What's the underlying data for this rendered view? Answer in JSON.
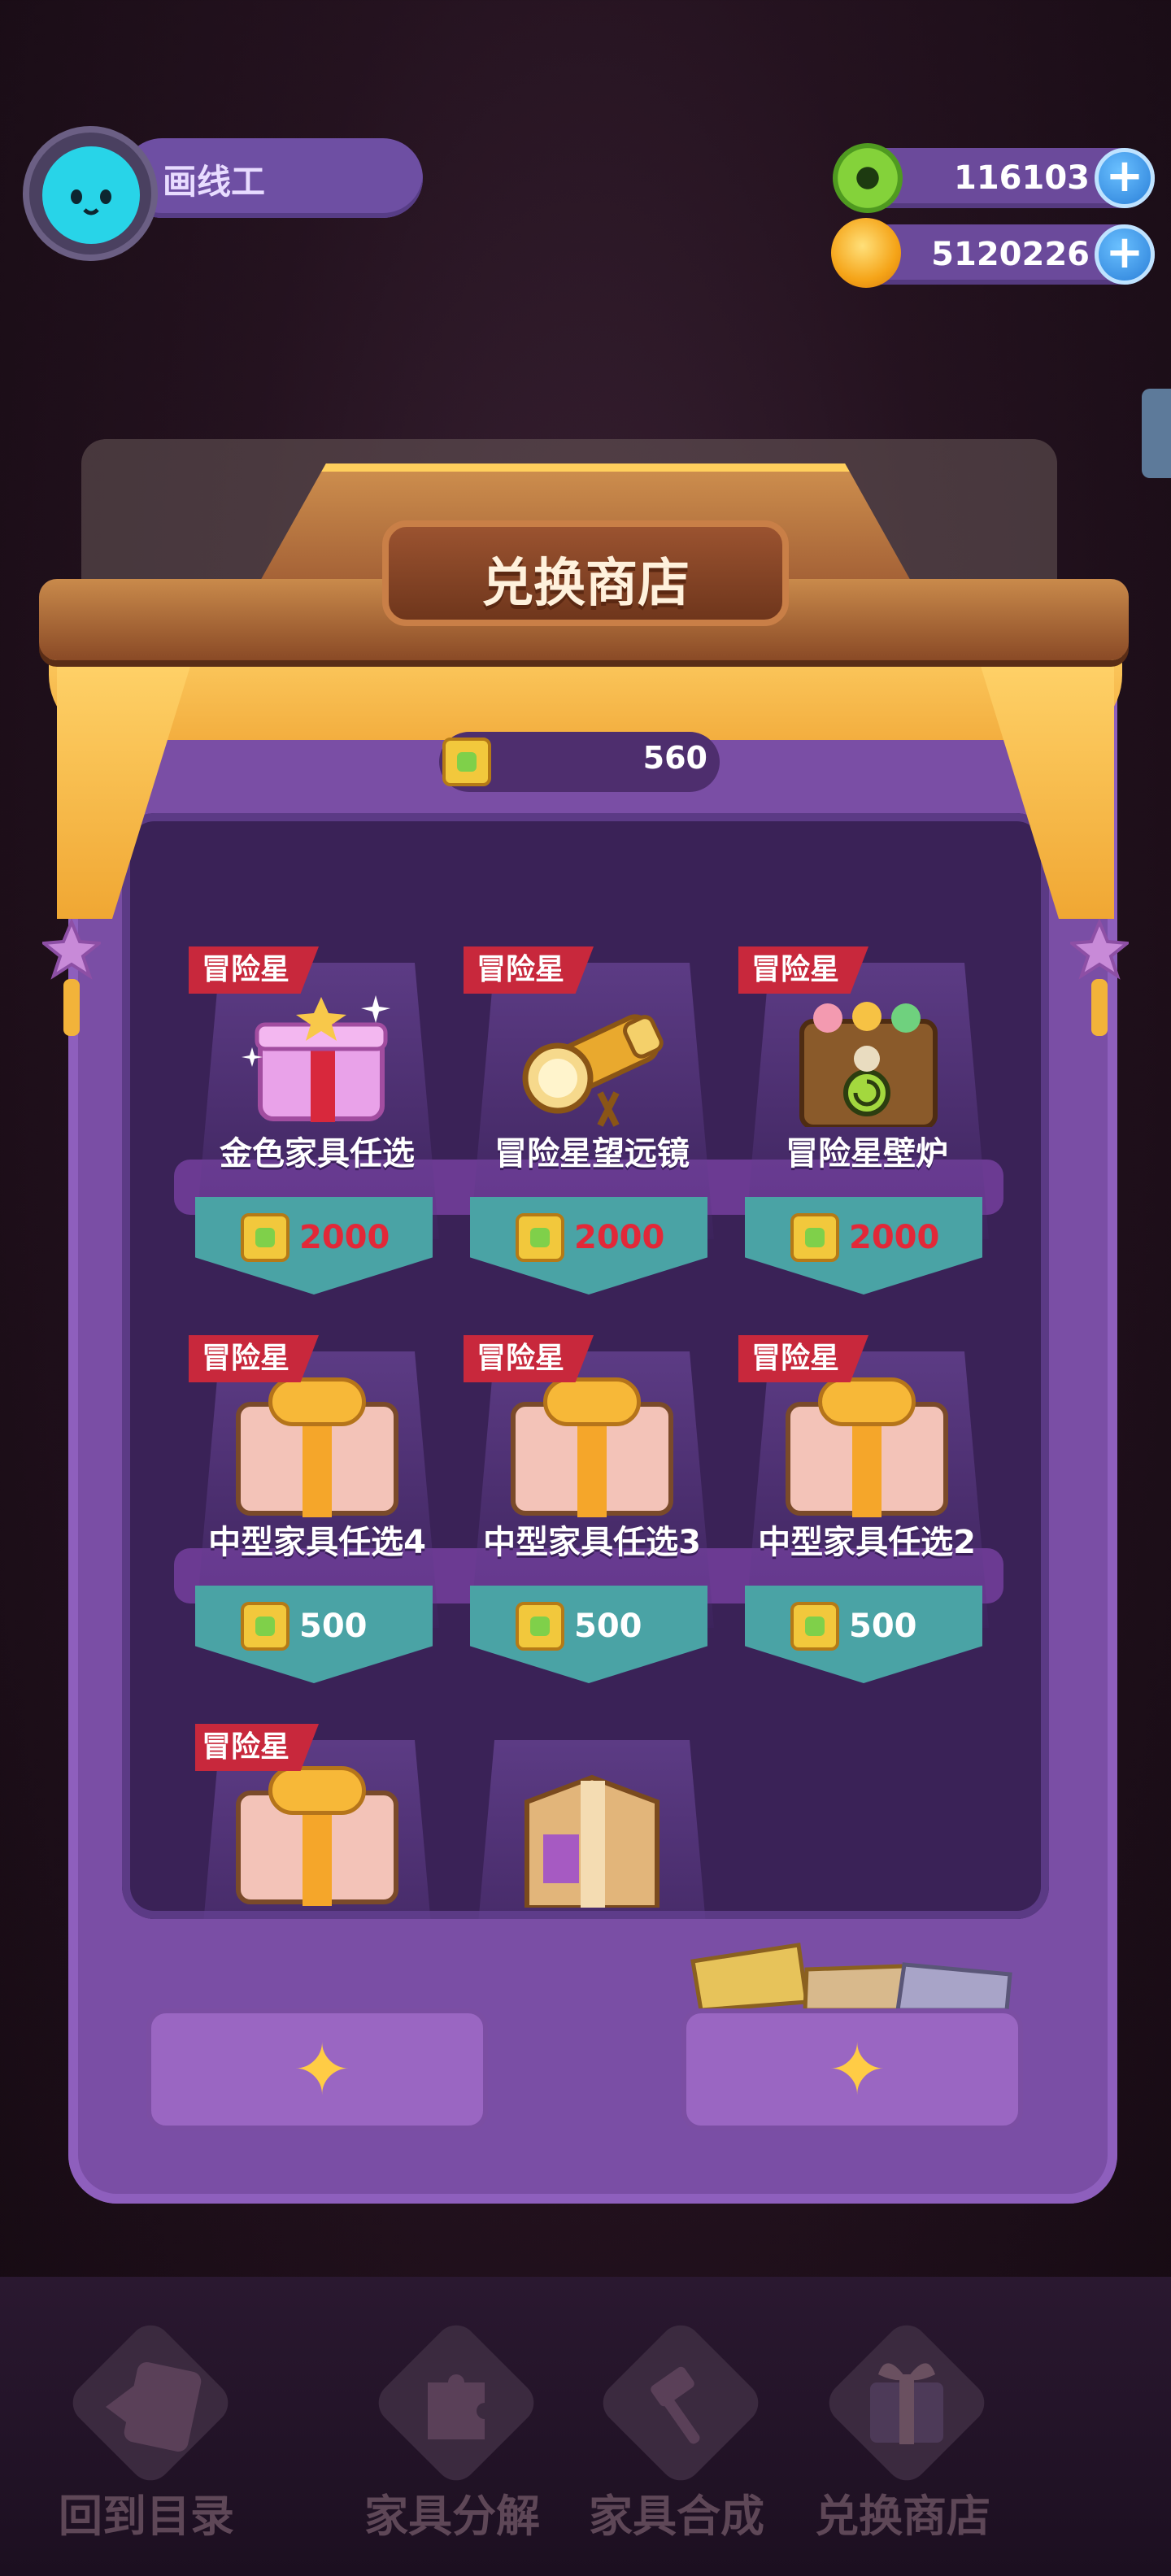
{
  "player": {
    "name": "画线工"
  },
  "currencies": [
    {
      "icon": "green-donut-coin-icon",
      "value": "116103"
    },
    {
      "icon": "orange-planet-coin-icon",
      "value": "5120226"
    }
  ],
  "shop": {
    "title": "兑换商店",
    "balance": "560",
    "items": [
      {
        "tag": "冒险星",
        "name": "金色家具任选",
        "price": "2000",
        "price_color": "#e22838",
        "icon": "pink-gift-box-icon"
      },
      {
        "tag": "冒险星",
        "name": "冒险星望远镜",
        "price": "2000",
        "price_color": "#e22838",
        "icon": "golden-telescope-icon"
      },
      {
        "tag": "冒险星",
        "name": "冒险星壁炉",
        "price": "2000",
        "price_color": "#e22838",
        "icon": "stump-fireplace-icon"
      },
      {
        "tag": "冒险星",
        "name": "中型家具任选4",
        "price": "500",
        "price_color": "#ffffff",
        "icon": "gift-box-icon"
      },
      {
        "tag": "冒险星",
        "name": "中型家具任选3",
        "price": "500",
        "price_color": "#ffffff",
        "icon": "gift-box-icon"
      },
      {
        "tag": "冒险星",
        "name": "中型家具任选2",
        "price": "500",
        "price_color": "#ffffff",
        "icon": "gift-box-icon"
      },
      {
        "tag": "冒险星",
        "name": "",
        "price": "",
        "icon": "gift-box-icon"
      },
      {
        "tag": "",
        "name": "",
        "price": "",
        "icon": "cardboard-box-icon"
      }
    ]
  },
  "bottom_nav": [
    {
      "label": "回到目录",
      "icon": "back-card-icon"
    },
    {
      "label": "家具分解",
      "icon": "puzzle-icon"
    },
    {
      "label": "家具合成",
      "icon": "hammer-icon"
    },
    {
      "label": "兑换商店",
      "icon": "gift-icon"
    }
  ]
}
